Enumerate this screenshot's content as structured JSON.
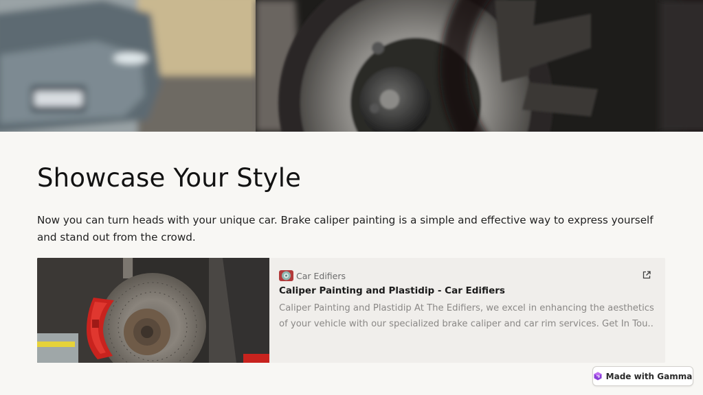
{
  "hero": {
    "image": "blurred-sedan-and-brake-disc-photo"
  },
  "title": "Showcase Your Style",
  "lead": "Now you can turn heads with your unique car. Brake caliper painting is a simple and effective way to express yourself and stand out from the crowd.",
  "card": {
    "thumbnail": "red-brake-caliper-photo",
    "source": "Car Edifiers",
    "title": "Caliper Painting and Plastidip - Car Edifiers",
    "desc_line1": "Caliper Painting and Plastidip At The Edifiers, we excel in enhancing the aesthetics",
    "desc_line2": "of your vehicle with our specialized brake caliper and car rim services. Get In Tou...",
    "icons": {
      "favicon": "car-edifiers-logo-icon",
      "open": "external-link-icon"
    }
  },
  "badge": {
    "label": "Made with Gamma",
    "icon": "gamma-logo-icon"
  },
  "colors": {
    "background": "#f8f7f4",
    "card": "#f0eeeb",
    "caliper": "#c8231e"
  }
}
